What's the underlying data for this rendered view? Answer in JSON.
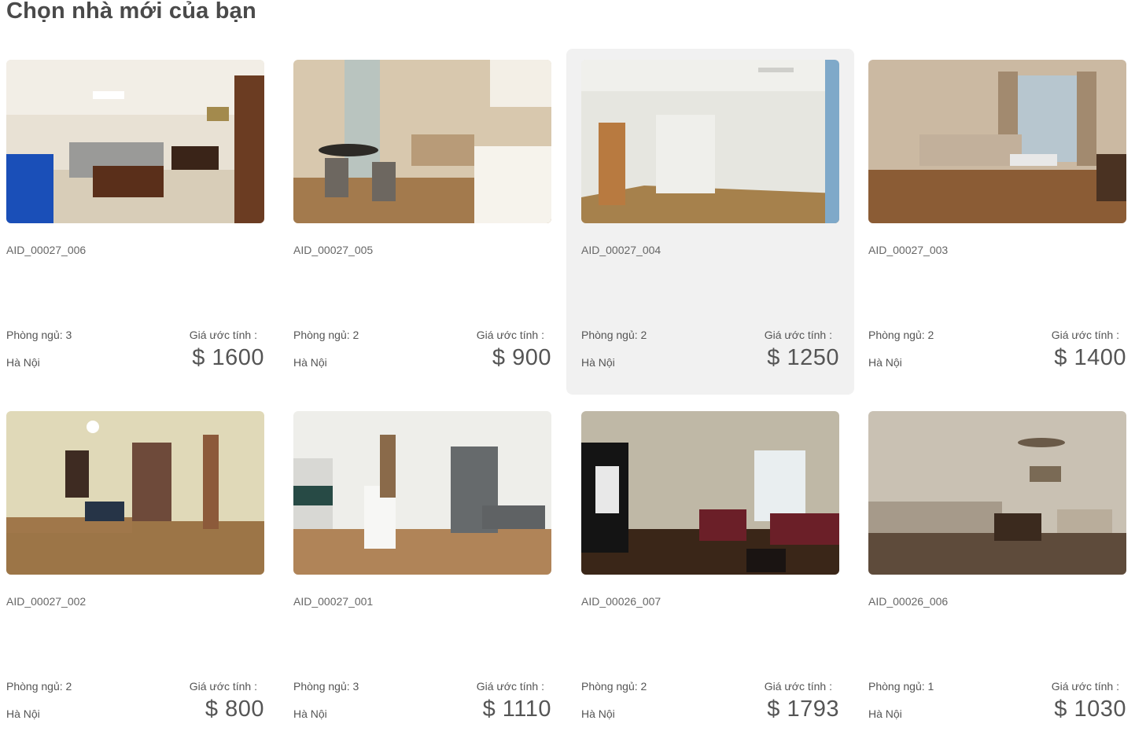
{
  "page": {
    "title": "Chọn nhà mới của bạn"
  },
  "listings": [
    {
      "code": "AID_00027_006",
      "bedrooms": "Phòng ngủ: 3",
      "price_label": "Giá ước tính :",
      "city": "Hà Nội",
      "price": "$ 1600"
    },
    {
      "code": "AID_00027_005",
      "bedrooms": "Phòng ngủ: 2",
      "price_label": "Giá ước tính :",
      "city": "Hà Nội",
      "price": "$ 900"
    },
    {
      "code": "AID_00027_004",
      "bedrooms": "Phòng ngủ: 2",
      "price_label": "Giá ước tính :",
      "city": "Hà Nội",
      "price": "$ 1250"
    },
    {
      "code": "AID_00027_003",
      "bedrooms": "Phòng ngủ: 2",
      "price_label": "Giá ước tính :",
      "city": "Hà Nội",
      "price": "$ 1400"
    },
    {
      "code": "AID_00027_002",
      "bedrooms": "Phòng ngủ: 2",
      "price_label": "Giá ước tính :",
      "city": "Hà Nội",
      "price": "$ 800"
    },
    {
      "code": "AID_00027_001",
      "bedrooms": "Phòng ngủ: 3",
      "price_label": "Giá ước tính :",
      "city": "Hà Nội",
      "price": "$ 1110"
    },
    {
      "code": "AID_00026_007",
      "bedrooms": "Phòng ngủ: 2",
      "price_label": "Giá ước tính :",
      "city": "Hà Nội",
      "price": "$ 1793"
    },
    {
      "code": "AID_00026_006",
      "bedrooms": "Phòng ngủ: 1",
      "price_label": "Giá ước tính :",
      "city": "Hà Nội",
      "price": "$ 1030"
    }
  ]
}
